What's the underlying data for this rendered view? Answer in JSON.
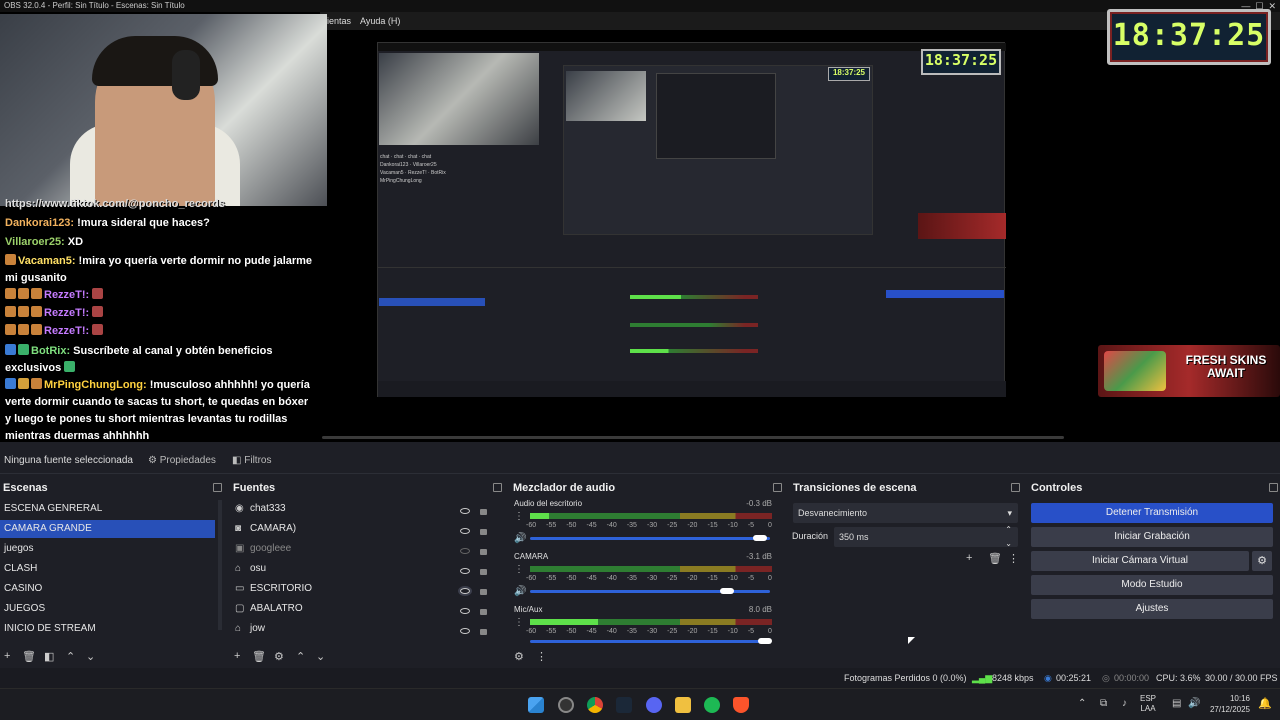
{
  "window": {
    "title": "OBS 32.0.4 - Perfil: Sin Título - Escenas: Sin Título"
  },
  "menu": {
    "items": [
      "ientas",
      "Ayuda (H)"
    ]
  },
  "overlay": {
    "clock": "18:37:25",
    "fresh_skins": "FRESH SKINS AWAIT"
  },
  "chat": {
    "lines": [
      {
        "user": "",
        "text": "https://www.tiktok.com/@poncho_records"
      },
      {
        "user": "Dankorai123:",
        "text": " !mura sideral que haces?"
      },
      {
        "user": "Villaroer25:",
        "text": " XD"
      },
      {
        "user": "Vacaman5:",
        "text": " !mira yo quería verte dormir no pude jalarme mi gusanito"
      },
      {
        "user": "RezzeT!:",
        "text": ""
      },
      {
        "user": "RezzeT!:",
        "text": ""
      },
      {
        "user": "RezzeT!:",
        "text": ""
      },
      {
        "user": "BotRix:",
        "text": " Suscríbete al canal y obtén beneficios exclusivos"
      },
      {
        "user": "MrPingChungLong:",
        "text": " !musculoso ahhhhh! yo quería verte dormir cuando te sacas tu short, te quedas en bóxer y luego te pones tu short mientras levantas tu rodillas mientras duermas ahhhhhh"
      }
    ]
  },
  "source_toolbar": {
    "no_source": "Ninguna fuente seleccionada",
    "properties": "Propiedades",
    "filters": "Filtros"
  },
  "scenes": {
    "title": "Escenas",
    "items": [
      "ESCENA GENRERAL",
      "CAMARA GRANDE",
      "juegos",
      "CLASH",
      "CASINO",
      "JUEGOS",
      "INICIO DE STREAM"
    ],
    "selected": "CAMARA GRANDE"
  },
  "sources": {
    "title": "Fuentes",
    "items": [
      {
        "name": "chat333",
        "icon": "globe-icon"
      },
      {
        "name": "CAMARA)",
        "icon": "camera-icon"
      },
      {
        "name": "googleee",
        "icon": "image-icon"
      },
      {
        "name": "osu",
        "icon": "game-capture-icon"
      },
      {
        "name": "ESCRITORIO",
        "icon": "monitor-icon"
      },
      {
        "name": "ABALATRO",
        "icon": "window-icon"
      },
      {
        "name": "jow",
        "icon": "game-capture-icon"
      }
    ]
  },
  "mixer": {
    "title": "Mezclador de audio",
    "ticks": [
      "-60",
      "-55",
      "-50",
      "-45",
      "-40",
      "-35",
      "-30",
      "-25",
      "-20",
      "-15",
      "-10",
      "-5",
      "0"
    ],
    "channels": [
      {
        "name": "Audio del escritorio",
        "db": "-0.3 dB",
        "level": 0.08,
        "volume": 0.96
      },
      {
        "name": "CAMARA",
        "db": "-3.1 dB",
        "level": 0.0,
        "volume": 0.82
      },
      {
        "name": "Mic/Aux",
        "db": "8.0 dB",
        "level": 0.28,
        "volume": 0.98
      }
    ]
  },
  "transitions": {
    "title": "Transiciones de escena",
    "selected": "Desvanecimiento",
    "duration_label": "Duración",
    "duration_value": "350 ms"
  },
  "controls": {
    "title": "Controles",
    "buttons": [
      "Detener Transmisión",
      "Iniciar Grabación",
      "Iniciar Cámara Virtual",
      "Modo Estudio",
      "Ajustes"
    ]
  },
  "status": {
    "dropped": "Fotogramas Perdidos 0 (0.0%)",
    "bitrate": "8248 kbps",
    "stream_time": "00:25:21",
    "rec_time": "00:00:00",
    "cpu": "CPU: 3.6%",
    "fps": "30.00 / 30.00 FPS"
  },
  "taskbar": {
    "lang_1": "ESP",
    "lang_2": "LAA",
    "time": "10:16",
    "date": "27/12/2025"
  },
  "colors": {
    "accent": "#2850c8",
    "background": "#1e1f26"
  }
}
